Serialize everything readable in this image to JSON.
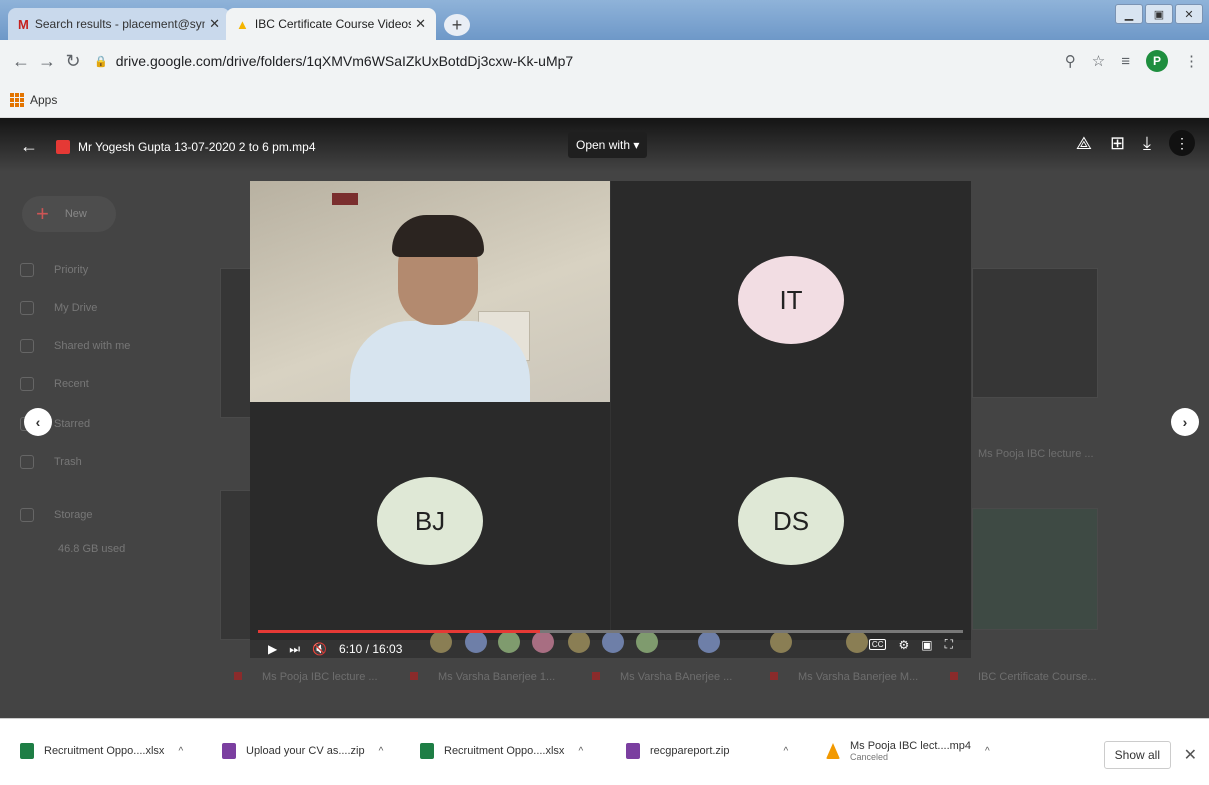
{
  "browser": {
    "tabs": [
      {
        "title": "Search results - placement@sym",
        "icon": "gmail-icon",
        "active": false
      },
      {
        "title": "IBC Certificate Course Videos - 1",
        "icon": "drive-icon",
        "active": true
      }
    ],
    "url": "drive.google.com/drive/folders/1qXMVm6WSaIZkUxBotdDj3cxw-Kk-uMp7",
    "bookmarks": [
      {
        "label": "Apps"
      }
    ],
    "profile_initial": "P"
  },
  "viewer": {
    "file_title": "Mr Yogesh Gupta 13-07-2020 2 to 6 pm.mp4",
    "open_with_label": "Open with ▾",
    "participants": [
      {
        "initials": "IT",
        "color": "#f2dde3"
      },
      {
        "initials": "BJ",
        "color": "#dfe8d6"
      },
      {
        "initials": "DS",
        "color": "#dfe8d6"
      }
    ],
    "time_display": "6:10 / 16:03",
    "progress": 0.4
  },
  "drive_bg": {
    "new_label": "New",
    "sidebar": [
      "Priority",
      "My Drive",
      "Shared with me",
      "Recent",
      "Starred",
      "Trash",
      "Storage",
      "46.8 GB used"
    ],
    "thumb_titles": [
      "Ms Pooja IBC lecture ...",
      "Ms Varsha Banerjee 1...",
      "Ms Varsha BAnerjee ...",
      "Ms Varsha Banerjee M...",
      "IBC Certificate Course..."
    ]
  },
  "downloads": {
    "items": [
      {
        "name": "Recruitment Oppo....xlsx",
        "sub": "",
        "color": "#1e7e45"
      },
      {
        "name": "Upload your CV as....zip",
        "sub": "",
        "color": "#7b3fa0"
      },
      {
        "name": "Recruitment Oppo....xlsx",
        "sub": "",
        "color": "#1e7e45"
      },
      {
        "name": "recgpareport.zip",
        "sub": "",
        "color": "#7b3fa0"
      },
      {
        "name": "Ms Pooja IBC lect....mp4",
        "sub": "Canceled",
        "color": "#f29900"
      }
    ],
    "show_all_label": "Show all"
  }
}
